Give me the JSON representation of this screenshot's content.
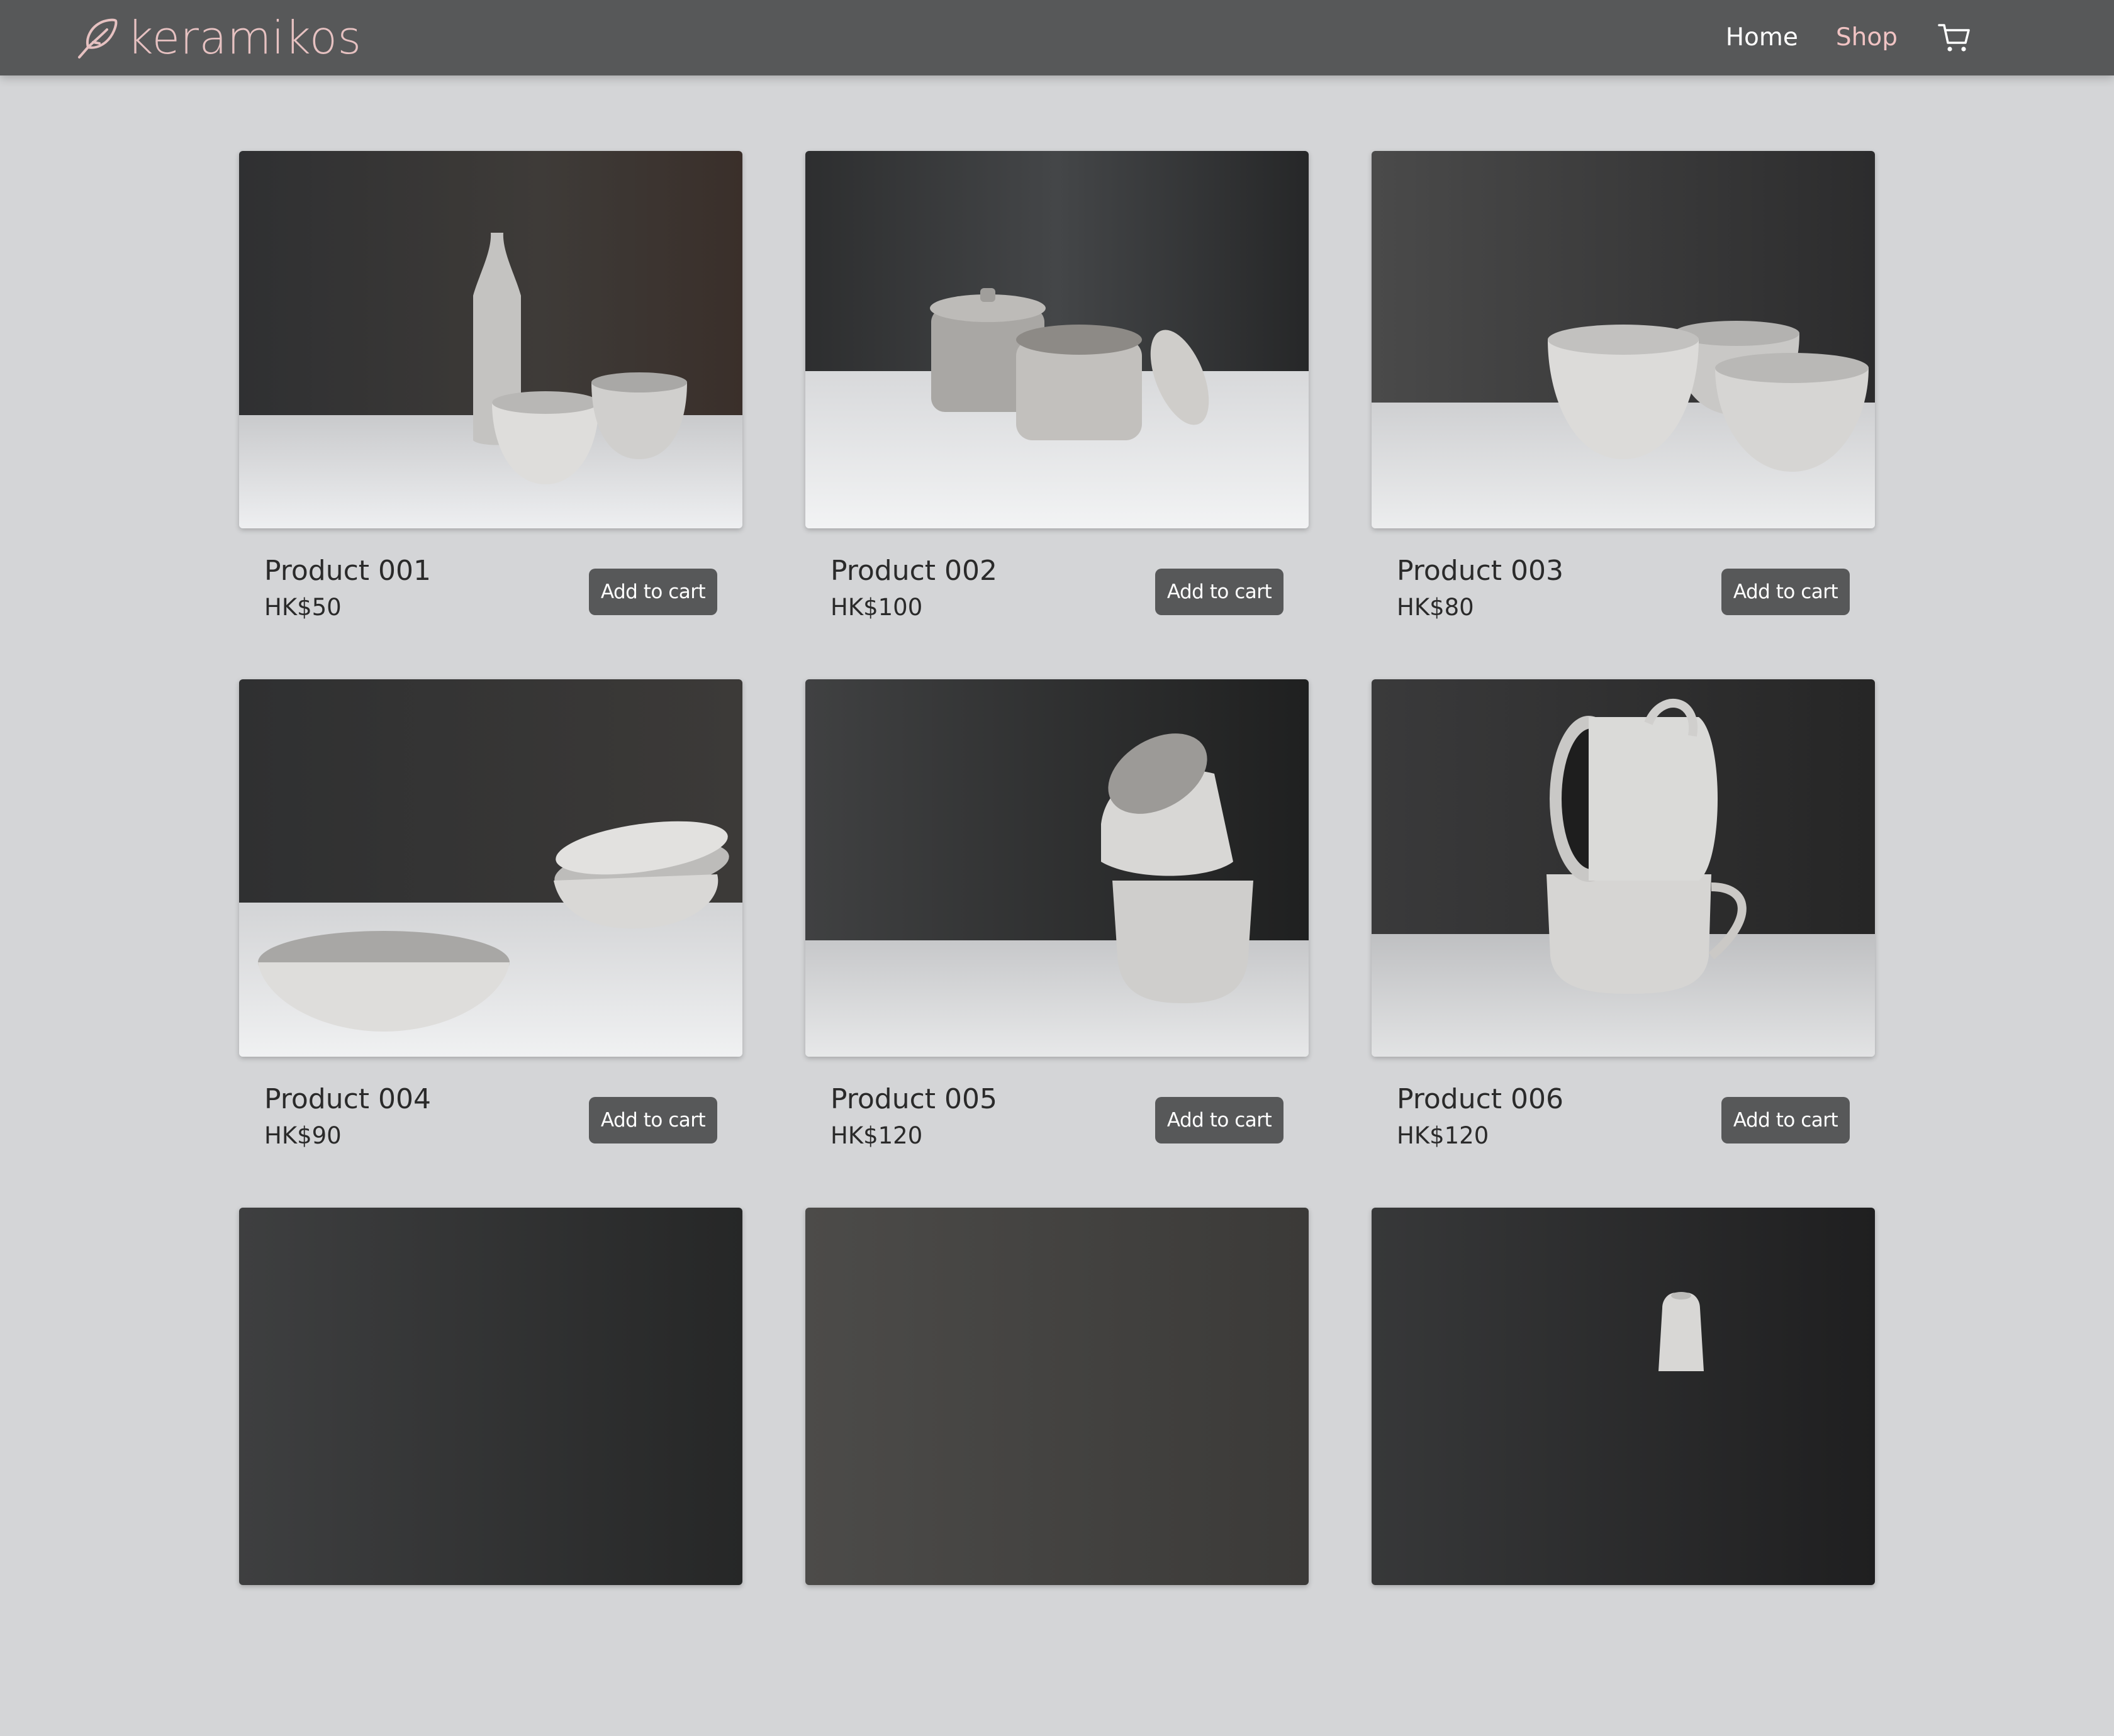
{
  "brand": {
    "name": "keramikos",
    "icon": "feather-leaf-icon",
    "color": "#e6c1c1"
  },
  "nav": {
    "home_label": "Home",
    "shop_label": "Shop",
    "cart_icon": "shopping-cart-icon",
    "active": "Shop",
    "active_color": "#f0c3c3"
  },
  "products": [
    {
      "name": "Product 001",
      "price": "HK$50",
      "button": "Add to cart",
      "image": "ceramic bottle and two cups"
    },
    {
      "name": "Product 002",
      "price": "HK$100",
      "button": "Add to cart",
      "image": "two lidded jars"
    },
    {
      "name": "Product 003",
      "price": "HK$80",
      "button": "Add to cart",
      "image": "three bowls"
    },
    {
      "name": "Product 004",
      "price": "HK$90",
      "button": "Add to cart",
      "image": "stacked plates and a shallow bowl"
    },
    {
      "name": "Product 005",
      "price": "HK$120",
      "button": "Add to cart",
      "image": "two stacked cups"
    },
    {
      "name": "Product 006",
      "price": "HK$120",
      "button": "Add to cart",
      "image": "two stacked mugs"
    },
    {
      "name": "",
      "price": "",
      "button": "",
      "image": "product photo (cut off)"
    },
    {
      "name": "",
      "price": "",
      "button": "",
      "image": "product photo (cut off)"
    },
    {
      "name": "",
      "price": "",
      "button": "",
      "image": "small vase (cut off)"
    }
  ],
  "colors": {
    "page_background": "#d4d5d7",
    "navbar": "#575859",
    "button": "#575859",
    "text": "#2a2a2a"
  }
}
